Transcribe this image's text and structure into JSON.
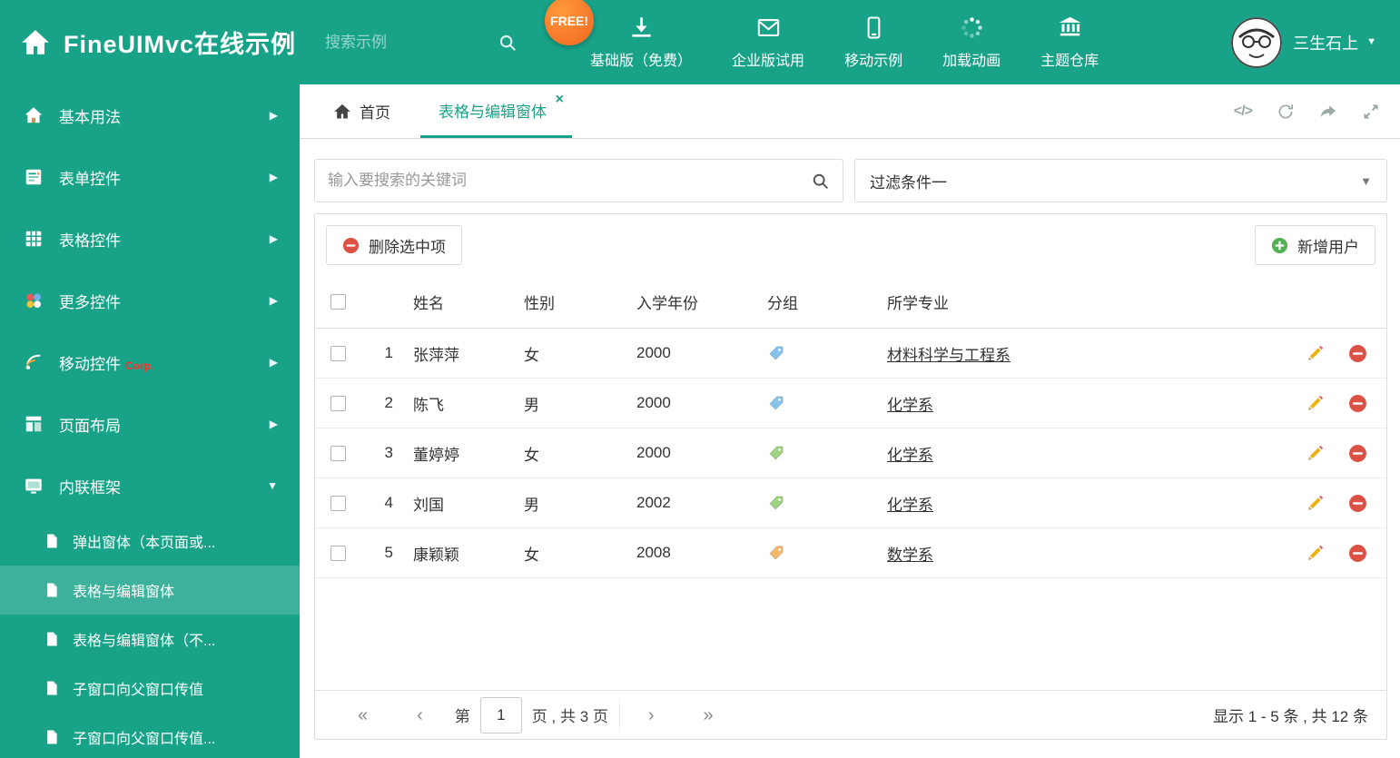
{
  "colors": {
    "theme": "#18a389",
    "badge_orange": "#f26522",
    "danger": "#dd5044",
    "success": "#52b152",
    "pencil_yellow": "#edb112",
    "tag_blue": "#85c5ec",
    "tag_green": "#9ed47f",
    "tag_orange": "#f5b86d"
  },
  "icons": {
    "expand": "▶",
    "collapse": "▼",
    "caret_down": "▼",
    "pager_first": "«",
    "pager_prev": "‹",
    "pager_next": "›",
    "pager_last": "»",
    "close": "×",
    "code": "</>"
  },
  "header": {
    "title": "FineUIMvc在线示例",
    "search_placeholder": "搜索示例",
    "free_badge": "FREE!",
    "nav": [
      {
        "label": "基础版（免费）",
        "icon": "download-icon"
      },
      {
        "label": "企业版试用",
        "icon": "envelope-icon"
      },
      {
        "label": "移动示例",
        "icon": "mobile-icon"
      },
      {
        "label": "加载动画",
        "icon": "spinner-icon"
      },
      {
        "label": "主题仓库",
        "icon": "bank-icon"
      }
    ],
    "user_name": "三生石上"
  },
  "sidebar": {
    "items": [
      {
        "label": "基本用法"
      },
      {
        "label": "表单控件"
      },
      {
        "label": "表格控件"
      },
      {
        "label": "更多控件"
      },
      {
        "label": "移动控件",
        "tag": "Corp."
      },
      {
        "label": "页面布局"
      },
      {
        "label": "内联框架"
      }
    ],
    "subitems": [
      {
        "label": "弹出窗体（本页面或..."
      },
      {
        "label": "表格与编辑窗体"
      },
      {
        "label": "表格与编辑窗体（不..."
      },
      {
        "label": "子窗口向父窗口传值"
      },
      {
        "label": "子窗口向父窗口传值..."
      }
    ]
  },
  "tabs": {
    "home": "首页",
    "active": "表格与编辑窗体"
  },
  "filter": {
    "search_placeholder": "输入要搜索的关键词",
    "dropdown_value": "过滤条件一"
  },
  "toolbar": {
    "delete_label": "删除选中项",
    "add_label": "新增用户"
  },
  "table": {
    "columns": {
      "name": "姓名",
      "gender": "性别",
      "year": "入学年份",
      "group": "分组",
      "major": "所学专业"
    },
    "rows": [
      {
        "index": "1",
        "name": "张萍萍",
        "gender": "女",
        "year": "2000",
        "tag_style": "color:#85c5ec",
        "major": "材料科学与工程系"
      },
      {
        "index": "2",
        "name": "陈飞",
        "gender": "男",
        "year": "2000",
        "tag_style": "color:#85c5ec",
        "major": "化学系"
      },
      {
        "index": "3",
        "name": "董婷婷",
        "gender": "女",
        "year": "2000",
        "tag_style": "color:#9ed47f",
        "major": "化学系"
      },
      {
        "index": "4",
        "name": "刘国",
        "gender": "男",
        "year": "2002",
        "tag_style": "color:#9ed47f",
        "major": "化学系"
      },
      {
        "index": "5",
        "name": "康颖颖",
        "gender": "女",
        "year": "2008",
        "tag_style": "color:#f5b86d",
        "major": "数学系"
      }
    ]
  },
  "pagination": {
    "page_prefix": "第",
    "current_page": "1",
    "page_suffix": "页 , 共 3 页",
    "summary": "显示 1 - 5 条 , 共 12 条"
  }
}
